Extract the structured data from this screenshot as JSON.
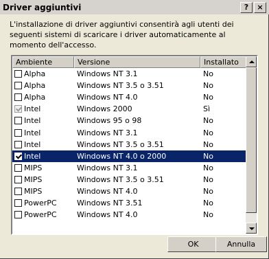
{
  "window": {
    "title": "Driver aggiuntivi",
    "help_label": "?",
    "close_label": "×"
  },
  "description": "L'installazione di driver aggiuntivi consentirà agli utenti dei seguenti sistemi di scaricare i driver automaticamente al momento dell'accesso.",
  "columns": [
    "Ambiente",
    "Versione",
    "Installato"
  ],
  "rows": [
    {
      "env": "Alpha",
      "version": "Windows NT 3.1",
      "installed": "No",
      "checked": false,
      "grayed": false,
      "selected": false
    },
    {
      "env": "Alpha",
      "version": "Windows NT 3.5 o 3.51",
      "installed": "No",
      "checked": false,
      "grayed": false,
      "selected": false
    },
    {
      "env": "Alpha",
      "version": "Windows NT 4.0",
      "installed": "No",
      "checked": false,
      "grayed": false,
      "selected": false
    },
    {
      "env": "Intel",
      "version": "Windows 2000",
      "installed": "Sì",
      "checked": true,
      "grayed": true,
      "selected": false
    },
    {
      "env": "Intel",
      "version": "Windows 95 o 98",
      "installed": "No",
      "checked": false,
      "grayed": false,
      "selected": false
    },
    {
      "env": "Intel",
      "version": "Windows NT 3.1",
      "installed": "No",
      "checked": false,
      "grayed": false,
      "selected": false
    },
    {
      "env": "Intel",
      "version": "Windows NT 3.5 o 3.51",
      "installed": "No",
      "checked": false,
      "grayed": false,
      "selected": false
    },
    {
      "env": "Intel",
      "version": "Windows NT 4.0 o 2000",
      "installed": "No",
      "checked": true,
      "grayed": false,
      "selected": true
    },
    {
      "env": "MIPS",
      "version": "Windows NT 3.1",
      "installed": "No",
      "checked": false,
      "grayed": false,
      "selected": false
    },
    {
      "env": "MIPS",
      "version": "Windows NT 3.5 o 3.51",
      "installed": "No",
      "checked": false,
      "grayed": false,
      "selected": false
    },
    {
      "env": "MIPS",
      "version": "Windows NT 4.0",
      "installed": "No",
      "checked": false,
      "grayed": false,
      "selected": false
    },
    {
      "env": "PowerPC",
      "version": "Windows NT 3.51",
      "installed": "No",
      "checked": false,
      "grayed": false,
      "selected": false
    },
    {
      "env": "PowerPC",
      "version": "Windows NT 4.0",
      "installed": "No",
      "checked": false,
      "grayed": false,
      "selected": false
    }
  ],
  "buttons": {
    "ok_label": "OK",
    "cancel_label": "Annulla"
  },
  "colors": {
    "selection": "#0a246a",
    "face": "#d4d0c8"
  }
}
